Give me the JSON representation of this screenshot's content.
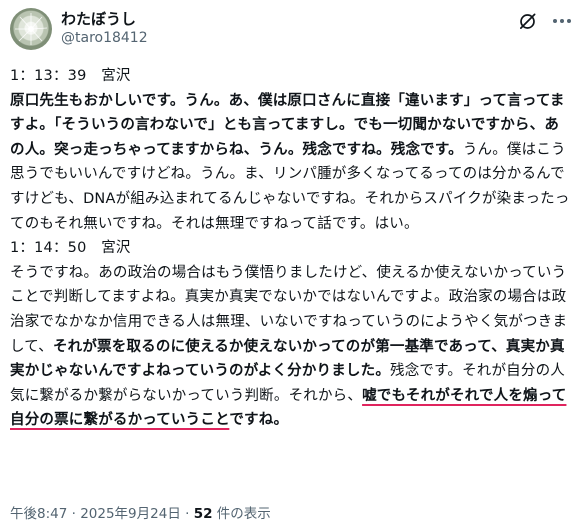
{
  "author": {
    "display_name": "わたぼうし",
    "handle": "@taro18412"
  },
  "icons": {
    "avatar": "dandelion-avatar",
    "grok": "grok-icon",
    "more": "more-icon"
  },
  "body": {
    "ts1": "1：13：39　宮沢",
    "p1_b1": "原口先生もおかしいです。うん。あ、僕は原口さんに直接「違います」って言ってますよ。「そういうの言わないで」とも言ってますし。でも一切聞かないですから、あの人。突っ走っちゃってますからね、うん。残念ですね。残念です。",
    "p1_n1": "うん。僕はこう思うでもいいんですけどね。うん。ま、リンパ腫が多くなってるってのは分かるんですけども、DNAが組み込まれてるんじゃないですね。それからスパイクが染まったってのもそれ無いですね。それは無理ですねって話です。はい。",
    "ts2": "1：14：50　宮沢",
    "p2_n1": "そうですね。あの政治の場合はもう僕悟りましたけど、使えるか使えないかっていうことで判断してますよね。真実か真実でないかではないんですよ。政治家の場合は政治家でなかなか信用できる人は無理、いないですねっていうのにようやく気がつきまして、",
    "p2_b1": "それが票を取るのに使えるか使えないかってのが第一基準であって、真実か真実かじゃないんですよねっていうのがよく分かりました。",
    "p2_n2": "残念です。それが自分の人気に繋がるか繋がらないかっていう判断。それから、",
    "p2_u1": "嘘でもそれがそれで人を煽って自分の票に繋がるかっていうこと",
    "p2_b2": "ですね。"
  },
  "footer": {
    "time": "午後8:47",
    "sep1": " · ",
    "date": "2025年9月24日",
    "sep2": " · ",
    "views_count": "52",
    "views_label": " 件の表示"
  }
}
